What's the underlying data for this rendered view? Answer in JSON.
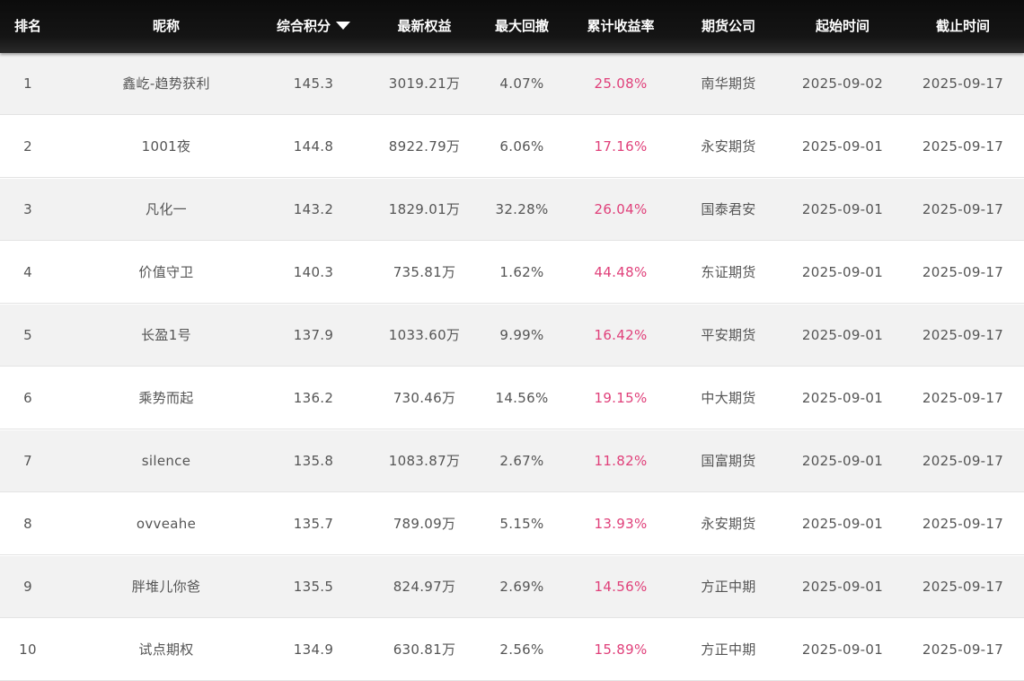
{
  "header": {
    "rank": "排名",
    "nickname": "昵称",
    "score": "综合积分",
    "equity": "最新权益",
    "drawdown": "最大回撤",
    "return": "累计收益率",
    "company": "期货公司",
    "start": "起始时间",
    "end": "截止时间",
    "sort_icon": "sort-desc-triangle-icon"
  },
  "colors": {
    "header_bg": "#111111",
    "header_text": "#ffffff",
    "row_alt_bg": "#f2f2f2",
    "text": "#555555",
    "return_text": "#e0407a"
  },
  "rows": [
    {
      "rank": "1",
      "nickname": "鑫屹-趋势获利",
      "score": "145.3",
      "equity": "3019.21万",
      "drawdown": "4.07%",
      "return": "25.08%",
      "company": "南华期货",
      "start": "2025-09-02",
      "end": "2025-09-17"
    },
    {
      "rank": "2",
      "nickname": "1001夜",
      "score": "144.8",
      "equity": "8922.79万",
      "drawdown": "6.06%",
      "return": "17.16%",
      "company": "永安期货",
      "start": "2025-09-01",
      "end": "2025-09-17"
    },
    {
      "rank": "3",
      "nickname": "凡化一",
      "score": "143.2",
      "equity": "1829.01万",
      "drawdown": "32.28%",
      "return": "26.04%",
      "company": "国泰君安",
      "start": "2025-09-01",
      "end": "2025-09-17"
    },
    {
      "rank": "4",
      "nickname": "价值守卫",
      "score": "140.3",
      "equity": "735.81万",
      "drawdown": "1.62%",
      "return": "44.48%",
      "company": "东证期货",
      "start": "2025-09-01",
      "end": "2025-09-17"
    },
    {
      "rank": "5",
      "nickname": "长盈1号",
      "score": "137.9",
      "equity": "1033.60万",
      "drawdown": "9.99%",
      "return": "16.42%",
      "company": "平安期货",
      "start": "2025-09-01",
      "end": "2025-09-17"
    },
    {
      "rank": "6",
      "nickname": "乘势而起",
      "score": "136.2",
      "equity": "730.46万",
      "drawdown": "14.56%",
      "return": "19.15%",
      "company": "中大期货",
      "start": "2025-09-01",
      "end": "2025-09-17"
    },
    {
      "rank": "7",
      "nickname": "silence",
      "score": "135.8",
      "equity": "1083.87万",
      "drawdown": "2.67%",
      "return": "11.82%",
      "company": "国富期货",
      "start": "2025-09-01",
      "end": "2025-09-17"
    },
    {
      "rank": "8",
      "nickname": "ovveahe",
      "score": "135.7",
      "equity": "789.09万",
      "drawdown": "5.15%",
      "return": "13.93%",
      "company": "永安期货",
      "start": "2025-09-01",
      "end": "2025-09-17"
    },
    {
      "rank": "9",
      "nickname": "胖堆儿你爸",
      "score": "135.5",
      "equity": "824.97万",
      "drawdown": "2.69%",
      "return": "14.56%",
      "company": "方正中期",
      "start": "2025-09-01",
      "end": "2025-09-17"
    },
    {
      "rank": "10",
      "nickname": "试点期权",
      "score": "134.9",
      "equity": "630.81万",
      "drawdown": "2.56%",
      "return": "15.89%",
      "company": "方正中期",
      "start": "2025-09-01",
      "end": "2025-09-17"
    }
  ]
}
